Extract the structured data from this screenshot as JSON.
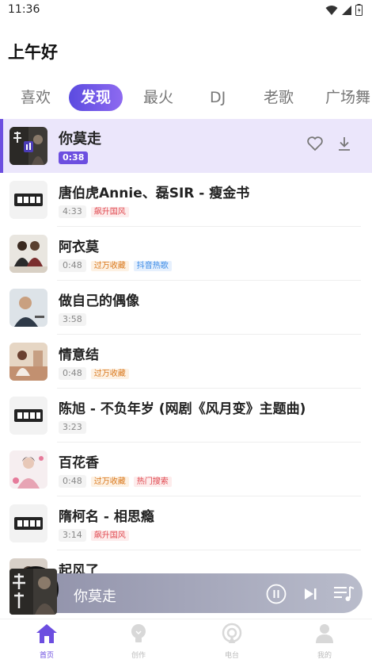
{
  "status": {
    "time": "11:36"
  },
  "greeting": "上午好",
  "tabs": [
    {
      "label": "喜欢"
    },
    {
      "label": "发现"
    },
    {
      "label": "最火"
    },
    {
      "label": "DJ"
    },
    {
      "label": "老歌"
    },
    {
      "label": "广场舞"
    }
  ],
  "songs": [
    {
      "title": "你莫走",
      "duration": "0:38",
      "tags": []
    },
    {
      "title": "唐伯虎Annie、磊SIR - 瘦金书",
      "duration": "4:33",
      "tags": [
        "飙升国风"
      ]
    },
    {
      "title": "阿衣莫",
      "duration": "0:48",
      "tags": [
        "过万收藏",
        "抖音热歌"
      ]
    },
    {
      "title": "做自己的偶像",
      "duration": "3:58",
      "tags": []
    },
    {
      "title": "情意结",
      "duration": "0:48",
      "tags": [
        "过万收藏"
      ]
    },
    {
      "title": "陈旭 - 不负年岁 (网剧《风月变》主题曲)",
      "duration": "3:23",
      "tags": []
    },
    {
      "title": "百花香",
      "duration": "0:48",
      "tags": [
        "过万收藏",
        "热门搜索"
      ]
    },
    {
      "title": "隋柯名 - 相思瘾",
      "duration": "3:14",
      "tags": [
        "飙升国风"
      ]
    },
    {
      "title": "起风了",
      "duration": "",
      "tags": []
    }
  ],
  "player": {
    "title": "你莫走"
  },
  "nav": [
    {
      "label": "首页"
    },
    {
      "label": "创作"
    },
    {
      "label": "电台"
    },
    {
      "label": "我的"
    }
  ],
  "colors": {
    "accent": "#6c4ee0",
    "active_row": "#ebe6fb",
    "tag_red": "#e0484f",
    "tag_orange": "#d9781c",
    "tag_blue": "#3a8ae6"
  }
}
